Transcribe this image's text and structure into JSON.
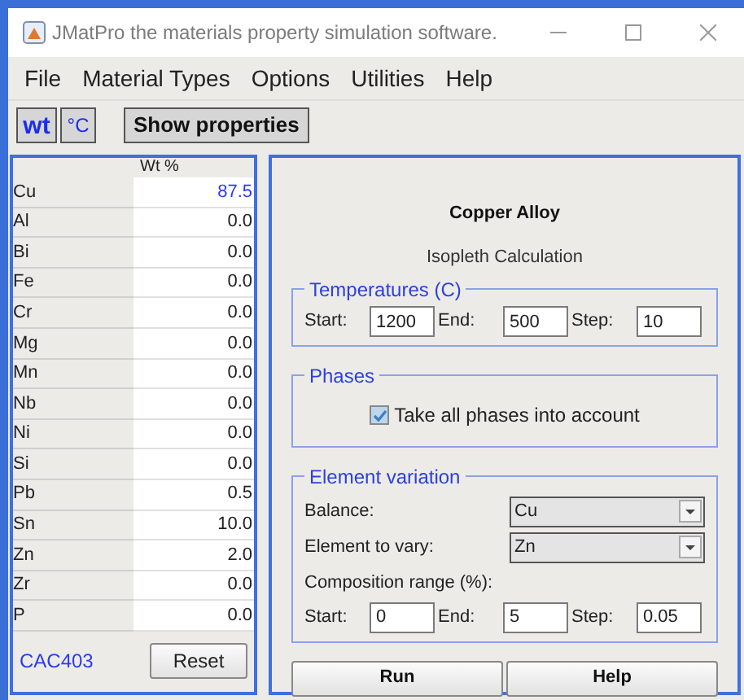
{
  "window": {
    "title": "JMatPro the materials property simulation software."
  },
  "menu": [
    "File",
    "Material Types",
    "Options",
    "Utilities",
    "Help"
  ],
  "toolbar": {
    "unit_buttons": [
      "wt",
      "°C"
    ],
    "show_properties": "Show properties"
  },
  "composition": {
    "header": "Wt %",
    "rows": [
      {
        "element": "Cu",
        "value": "87.5",
        "balance": true
      },
      {
        "element": "Al",
        "value": "0.0",
        "balance": false
      },
      {
        "element": "Bi",
        "value": "0.0",
        "balance": false
      },
      {
        "element": "Fe",
        "value": "0.0",
        "balance": false
      },
      {
        "element": "Cr",
        "value": "0.0",
        "balance": false
      },
      {
        "element": "Mg",
        "value": "0.0",
        "balance": false
      },
      {
        "element": "Mn",
        "value": "0.0",
        "balance": false
      },
      {
        "element": "Nb",
        "value": "0.0",
        "balance": false
      },
      {
        "element": "Ni",
        "value": "0.0",
        "balance": false
      },
      {
        "element": "Si",
        "value": "0.0",
        "balance": false
      },
      {
        "element": "Pb",
        "value": "0.5",
        "balance": false
      },
      {
        "element": "Sn",
        "value": "10.0",
        "balance": false
      },
      {
        "element": "Zn",
        "value": "2.0",
        "balance": false
      },
      {
        "element": "Zr",
        "value": "0.0",
        "balance": false
      },
      {
        "element": "P",
        "value": "0.0",
        "balance": false
      }
    ],
    "alloy_name": "CAC403",
    "reset": "Reset"
  },
  "calculation": {
    "title": "Copper Alloy",
    "subtitle": "Isopleth Calculation",
    "temperatures": {
      "legend": "Temperatures (C)",
      "fields": [
        {
          "label": "Start:",
          "value": "1200"
        },
        {
          "label": "End:",
          "value": "500"
        },
        {
          "label": "Step:",
          "value": "10"
        }
      ]
    },
    "phases": {
      "legend": "Phases",
      "checkbox": {
        "label": "Take all phases into account",
        "checked": true
      }
    },
    "element_variation": {
      "legend": "Element variation",
      "selects": [
        {
          "label": "Balance:",
          "value": "Cu"
        },
        {
          "label": "Element to vary:",
          "value": "Zn"
        }
      ],
      "range_label": "Composition range (%):",
      "fields": [
        {
          "label": "Start:",
          "value": "0"
        },
        {
          "label": "End:",
          "value": "5"
        },
        {
          "label": "Step:",
          "value": "0.05"
        }
      ]
    },
    "buttons": [
      "Run",
      "Help"
    ]
  }
}
